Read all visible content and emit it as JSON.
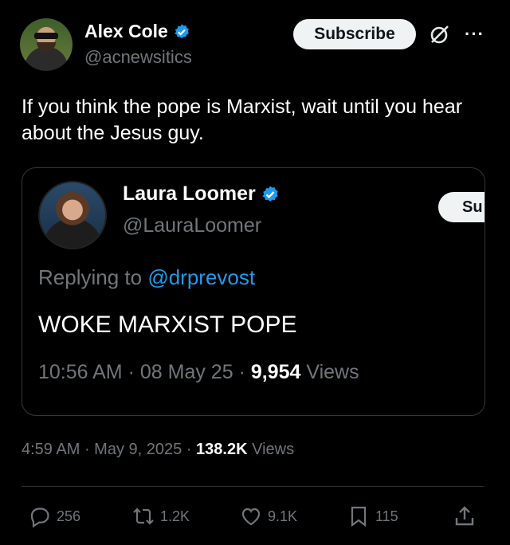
{
  "author": {
    "name": "Alex Cole",
    "handle": "@acnewsitics",
    "subscribe_label": "Subscribe"
  },
  "tweet": {
    "text": "If you think the pope is Marxist, wait until you hear about the Jesus guy."
  },
  "quoted": {
    "name": "Laura Loomer",
    "handle": "@LauraLoomer",
    "subscribe_label": "Su",
    "replying_prefix": "Replying to",
    "replying_to": "@drprevost",
    "text": "WOKE MARXIST POPE",
    "time": "10:56 AM",
    "date": "08 May 25",
    "views_count": "9,954",
    "views_label": "Views"
  },
  "meta": {
    "time": "4:59 AM",
    "date": "May 9, 2025",
    "views_count": "138.2K",
    "views_label": "Views"
  },
  "actions": {
    "replies": "256",
    "reposts": "1.2K",
    "likes": "9.1K",
    "bookmarks": "115"
  },
  "colors": {
    "background": "#000000",
    "verified": "#1d9bf0",
    "muted": "#71767b"
  }
}
